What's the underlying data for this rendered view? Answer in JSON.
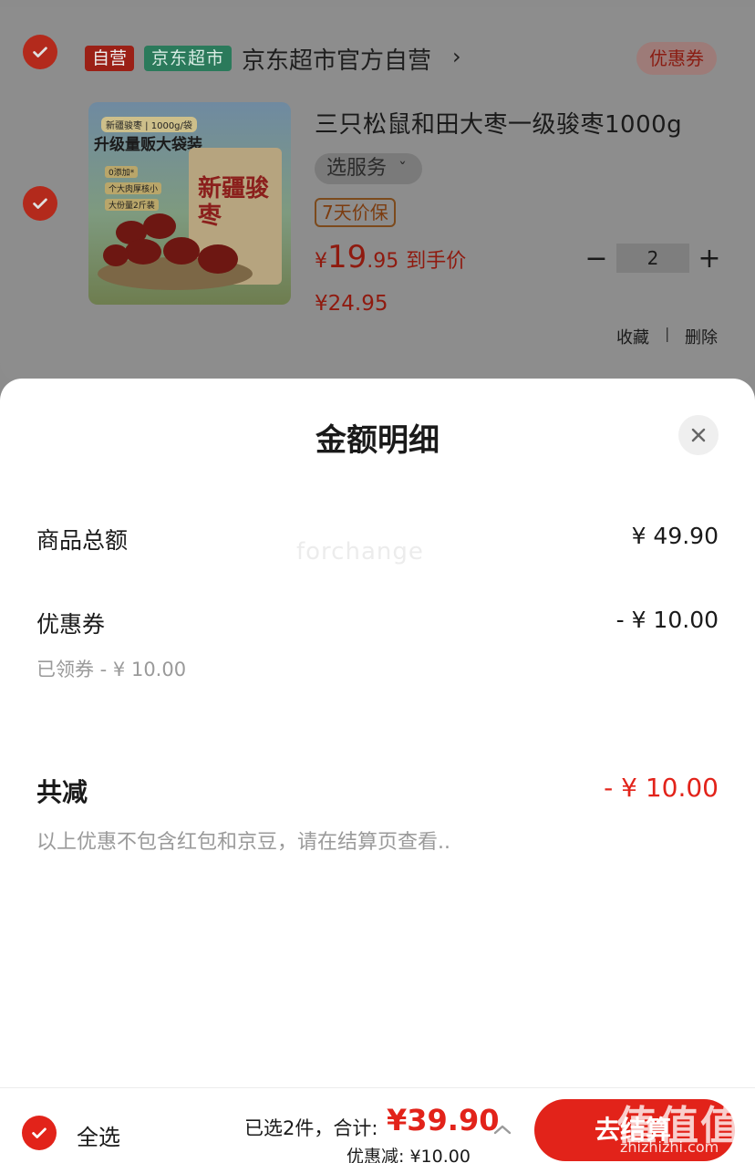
{
  "store": {
    "tag_self": "自营",
    "tag_market": "京东超市",
    "name": "京东超市官方自营",
    "arrow": "›",
    "coupon_chip": "优惠券"
  },
  "product": {
    "image_text": {
      "top": "新疆骏枣 | 1000g/袋",
      "title": "升级量贩大袋装",
      "bullets": [
        "0添加*",
        "个大肉厚核小",
        "大份量2斤装"
      ],
      "bag": "新疆骏枣"
    },
    "title": "三只松鼠和田大枣一级骏枣1000g",
    "service": "选服务",
    "service_caret": "ˇ",
    "guarantee": "7天价保",
    "price_yen": "¥",
    "price_int": "19",
    "price_dec": ".95",
    "price_label": "到手价",
    "price_original": "¥24.95",
    "quantity": "2",
    "minus": "−",
    "plus": "+",
    "action_fav": "收藏",
    "action_sep": "|",
    "action_delete": "删除"
  },
  "sheet": {
    "title": "金额明细",
    "rows": [
      {
        "label": "商品总额",
        "value": "¥ 49.90"
      },
      {
        "label": "优惠券",
        "value": "- ¥ 10.00",
        "sub": "已领券 - ¥ 10.00"
      }
    ],
    "total_label": "共减",
    "total_value": "- ¥ 10.00",
    "note": "以上优惠不包含红包和京豆，请在结算页查看..",
    "watermark": "forchange"
  },
  "bottom": {
    "select_all": "全选",
    "summary": "已选2件，合计:",
    "total": "¥39.90",
    "discount": "优惠减:  ¥10.00",
    "checkout": "去结算",
    "site_mark": "值值值",
    "site_url": "zhizhizhi.com"
  },
  "colors": {
    "accent": "#e2231a",
    "dim_overlay": "#8c8c8c",
    "sheet_bg": "#ffffff"
  }
}
